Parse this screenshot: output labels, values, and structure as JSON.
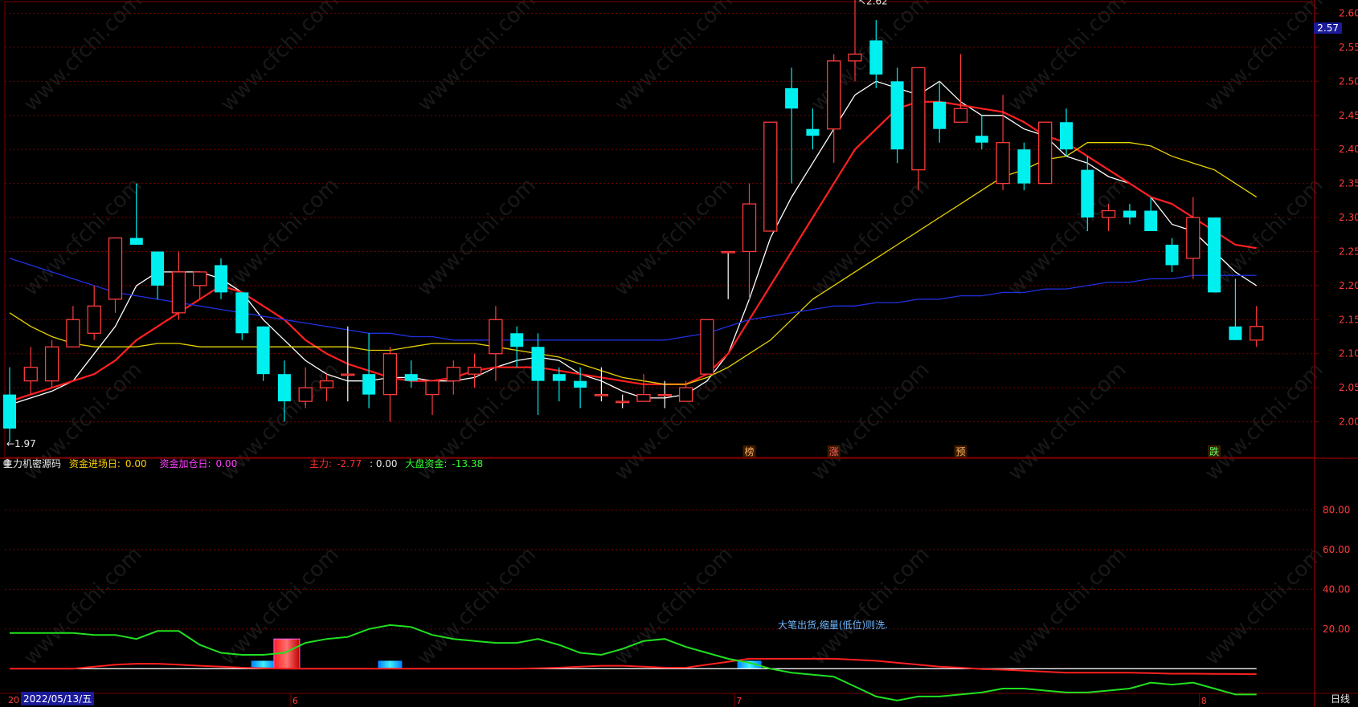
{
  "indicator": {
    "name": "主力机密源码",
    "entry_label": "资金进场日:",
    "entry_value": "0.00",
    "add_label": "资金加仓日:",
    "add_value": "0.00",
    "main_label": "主力:",
    "main_value": "-2.77",
    "colon_value": ": 0.00",
    "market_label": "大盘资金:",
    "market_value": "-13.38",
    "note": "大笔出货,缩量(低位)则洗."
  },
  "footer": {
    "left_stub": "20",
    "date": "2022/05/13/五",
    "period": "日线",
    "month_ticks": [
      "6",
      "7",
      "8"
    ]
  },
  "price_tag": "2.57",
  "watermark": "www.cfchi.com",
  "colors": {
    "up": "#ff3b3b",
    "down": "#00f0f0",
    "ma5": "#ffffff",
    "ma10": "#ff2020",
    "ma20": "#e6d200",
    "ma60": "#2030e0",
    "grid": "#7a0000",
    "axis_text": "#ff3b3b"
  },
  "chart_data": [
    {
      "type": "candlestick",
      "ylim": [
        1.95,
        2.61
      ],
      "yticks": [
        2.0,
        2.05,
        2.1,
        2.15,
        2.2,
        2.25,
        2.3,
        2.35,
        2.4,
        2.45,
        2.5,
        2.55,
        2.6
      ],
      "high_label": "2.62",
      "low_label": "1.97",
      "signals": [
        {
          "index": 35,
          "text": "榜",
          "color": "#ffb060"
        },
        {
          "index": 39,
          "text": "涨",
          "color": "#ff6060"
        },
        {
          "index": 45,
          "text": "预",
          "color": "#ffb060"
        },
        {
          "index": 57,
          "text": "跌",
          "color": "#60ff60"
        }
      ],
      "candles": [
        [
          2.04,
          1.99,
          2.08,
          1.97
        ],
        [
          2.06,
          2.08,
          2.11,
          2.04
        ],
        [
          2.06,
          2.11,
          2.12,
          2.05
        ],
        [
          2.11,
          2.15,
          2.17,
          2.11
        ],
        [
          2.13,
          2.17,
          2.2,
          2.12
        ],
        [
          2.18,
          2.27,
          2.27,
          2.16
        ],
        [
          2.27,
          2.26,
          2.35,
          2.26
        ],
        [
          2.25,
          2.2,
          2.25,
          2.18
        ],
        [
          2.16,
          2.22,
          2.25,
          2.15
        ],
        [
          2.2,
          2.22,
          2.22,
          2.18
        ],
        [
          2.23,
          2.19,
          2.24,
          2.18
        ],
        [
          2.19,
          2.13,
          2.19,
          2.12
        ],
        [
          2.14,
          2.07,
          2.14,
          2.06
        ],
        [
          2.07,
          2.03,
          2.09,
          2.0
        ],
        [
          2.03,
          2.05,
          2.08,
          2.02
        ],
        [
          2.05,
          2.06,
          2.07,
          2.03
        ],
        [
          2.07,
          2.07,
          2.14,
          2.03
        ],
        [
          2.07,
          2.04,
          2.13,
          2.02
        ],
        [
          2.04,
          2.1,
          2.11,
          2.0
        ],
        [
          2.07,
          2.06,
          2.09,
          2.05
        ],
        [
          2.04,
          2.06,
          2.06,
          2.01
        ],
        [
          2.06,
          2.08,
          2.09,
          2.04
        ],
        [
          2.07,
          2.08,
          2.1,
          2.05
        ],
        [
          2.1,
          2.15,
          2.17,
          2.06
        ],
        [
          2.13,
          2.11,
          2.14,
          2.08
        ],
        [
          2.11,
          2.06,
          2.13,
          2.01
        ],
        [
          2.07,
          2.06,
          2.08,
          2.03
        ],
        [
          2.06,
          2.05,
          2.08,
          2.02
        ],
        [
          2.04,
          2.04,
          2.08,
          2.03
        ],
        [
          2.03,
          2.03,
          2.04,
          2.02
        ],
        [
          2.03,
          2.04,
          2.07,
          2.03
        ],
        [
          2.04,
          2.04,
          2.06,
          2.02
        ],
        [
          2.03,
          2.05,
          2.06,
          2.03
        ],
        [
          2.07,
          2.15,
          2.15,
          2.07
        ],
        [
          2.25,
          2.25,
          2.25,
          2.18
        ],
        [
          2.25,
          2.32,
          2.35,
          2.18
        ],
        [
          2.28,
          2.44,
          2.44,
          2.28
        ],
        [
          2.49,
          2.46,
          2.52,
          2.35
        ],
        [
          2.43,
          2.42,
          2.46,
          2.4
        ],
        [
          2.43,
          2.53,
          2.54,
          2.38
        ],
        [
          2.53,
          2.54,
          2.62,
          2.5
        ],
        [
          2.56,
          2.51,
          2.59,
          2.49
        ],
        [
          2.5,
          2.4,
          2.52,
          2.38
        ],
        [
          2.37,
          2.52,
          2.52,
          2.34
        ],
        [
          2.47,
          2.43,
          2.5,
          2.41
        ],
        [
          2.44,
          2.46,
          2.54,
          2.44
        ],
        [
          2.42,
          2.41,
          2.45,
          2.4
        ],
        [
          2.35,
          2.41,
          2.48,
          2.34
        ],
        [
          2.4,
          2.35,
          2.41,
          2.34
        ],
        [
          2.35,
          2.44,
          2.44,
          2.35
        ],
        [
          2.44,
          2.4,
          2.46,
          2.39
        ],
        [
          2.37,
          2.3,
          2.39,
          2.28
        ],
        [
          2.3,
          2.31,
          2.32,
          2.28
        ],
        [
          2.31,
          2.3,
          2.32,
          2.29
        ],
        [
          2.31,
          2.28,
          2.33,
          2.28
        ],
        [
          2.26,
          2.23,
          2.27,
          2.22
        ],
        [
          2.24,
          2.3,
          2.33,
          2.21
        ],
        [
          2.3,
          2.19,
          2.3,
          2.19
        ],
        [
          2.14,
          2.12,
          2.21,
          2.12
        ],
        [
          2.12,
          2.14,
          2.17,
          2.11
        ]
      ],
      "ma_series": [
        {
          "key": "ma5",
          "values": [
            2.025,
            2.035,
            2.045,
            2.06,
            2.1,
            2.14,
            2.2,
            2.22,
            2.22,
            2.22,
            2.21,
            2.19,
            2.15,
            2.12,
            2.09,
            2.07,
            2.06,
            2.06,
            2.065,
            2.065,
            2.06,
            2.06,
            2.065,
            2.08,
            2.09,
            2.095,
            2.09,
            2.07,
            2.06,
            2.045,
            2.035,
            2.035,
            2.04,
            2.06,
            2.1,
            2.18,
            2.27,
            2.33,
            2.38,
            2.43,
            2.48,
            2.5,
            2.49,
            2.48,
            2.5,
            2.47,
            2.45,
            2.45,
            2.43,
            2.42,
            2.39,
            2.38,
            2.36,
            2.35,
            2.33,
            2.29,
            2.28,
            2.25,
            2.22,
            2.2
          ]
        },
        {
          "key": "ma10",
          "values": [
            2.03,
            2.04,
            2.05,
            2.06,
            2.07,
            2.09,
            2.12,
            2.14,
            2.16,
            2.18,
            2.2,
            2.19,
            2.17,
            2.15,
            2.12,
            2.1,
            2.085,
            2.075,
            2.065,
            2.06,
            2.06,
            2.065,
            2.075,
            2.08,
            2.08,
            2.08,
            2.075,
            2.07,
            2.065,
            2.06,
            2.055,
            2.055,
            2.055,
            2.07,
            2.1,
            2.15,
            2.2,
            2.25,
            2.3,
            2.35,
            2.4,
            2.43,
            2.46,
            2.47,
            2.47,
            2.465,
            2.46,
            2.455,
            2.44,
            2.42,
            2.41,
            2.39,
            2.37,
            2.35,
            2.33,
            2.32,
            2.3,
            2.28,
            2.26,
            2.255
          ]
        },
        {
          "key": "ma20",
          "values": [
            2.16,
            2.14,
            2.125,
            2.115,
            2.11,
            2.11,
            2.11,
            2.115,
            2.115,
            2.11,
            2.11,
            2.11,
            2.11,
            2.11,
            2.11,
            2.11,
            2.11,
            2.105,
            2.105,
            2.11,
            2.115,
            2.115,
            2.115,
            2.11,
            2.105,
            2.1,
            2.095,
            2.085,
            2.075,
            2.065,
            2.06,
            2.055,
            2.055,
            2.065,
            2.08,
            2.1,
            2.12,
            2.15,
            2.18,
            2.2,
            2.22,
            2.24,
            2.26,
            2.28,
            2.3,
            2.32,
            2.34,
            2.36,
            2.37,
            2.385,
            2.39,
            2.41,
            2.41,
            2.41,
            2.405,
            2.39,
            2.38,
            2.37,
            2.35,
            2.33
          ]
        },
        {
          "key": "ma60",
          "values": [
            2.24,
            2.23,
            2.22,
            2.21,
            2.2,
            2.19,
            2.185,
            2.18,
            2.175,
            2.17,
            2.165,
            2.16,
            2.155,
            2.15,
            2.145,
            2.14,
            2.135,
            2.13,
            2.13,
            2.125,
            2.125,
            2.12,
            2.12,
            2.12,
            2.12,
            2.12,
            2.12,
            2.12,
            2.12,
            2.12,
            2.12,
            2.12,
            2.125,
            2.13,
            2.14,
            2.15,
            2.155,
            2.16,
            2.165,
            2.17,
            2.17,
            2.175,
            2.175,
            2.18,
            2.18,
            2.185,
            2.185,
            2.19,
            2.19,
            2.195,
            2.195,
            2.2,
            2.205,
            2.205,
            2.21,
            2.21,
            2.215,
            2.215,
            2.215,
            2.215
          ]
        }
      ]
    },
    {
      "type": "indicator",
      "ylim": [
        -10,
        100
      ],
      "yticks": [
        20.0,
        40.0,
        60.0,
        80.0
      ],
      "green": [
        18,
        18,
        18,
        18,
        17,
        17,
        15,
        19,
        19,
        12,
        8,
        7,
        7,
        8,
        13,
        15,
        16,
        20,
        22,
        21,
        17,
        15,
        14,
        13,
        13,
        15,
        12,
        8,
        7,
        10,
        14,
        15,
        11,
        8,
        5,
        3,
        0,
        -2,
        -3,
        -4,
        -9,
        -14,
        -16,
        -14,
        -14,
        -13,
        -12,
        -10,
        -10,
        -11,
        -12,
        -12,
        -11,
        -10,
        -7,
        -8,
        -7,
        -10,
        -13,
        -13
      ],
      "red_line": [
        0,
        0,
        0,
        0,
        1,
        2,
        2.5,
        2.5,
        2,
        1.5,
        1,
        0.5,
        0.2,
        0,
        0,
        0,
        0,
        0,
        0,
        0,
        0,
        0,
        0,
        0,
        0,
        0.2,
        0.5,
        1,
        1.5,
        1.5,
        1,
        0.5,
        0.5,
        2,
        3.5,
        5,
        5,
        5,
        5,
        5,
        4.5,
        4,
        3,
        2,
        1,
        0.5,
        -0.2,
        -0.5,
        -1,
        -1.5,
        -2,
        -2,
        -2,
        -2,
        -2.2,
        -2.5,
        -2.5,
        -2.6,
        -2.7,
        -2.77
      ],
      "white_line": 0,
      "red_bars": [
        {
          "index": 13,
          "value": 15
        }
      ],
      "cyan_bars": [
        {
          "index": 12,
          "value": 4
        },
        {
          "index": 18,
          "value": 4
        },
        {
          "index": 35,
          "value": 4
        }
      ]
    }
  ]
}
